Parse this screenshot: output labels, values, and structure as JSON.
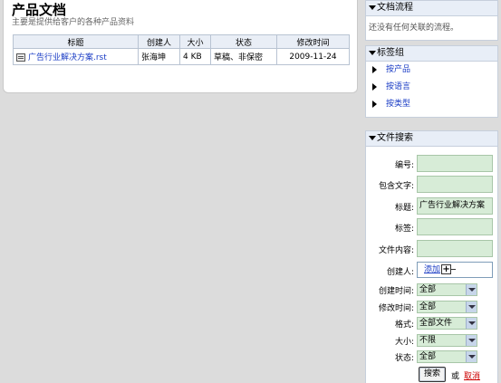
{
  "main": {
    "title": "产品文档",
    "subtitle": "主要是提供给客户的各种产品资料",
    "table": {
      "headers": [
        "标题",
        "创建人",
        "大小",
        "状态",
        "修改时间"
      ],
      "rows": [
        {
          "title": "广告行业解决方案.rst",
          "creator": "张海坤",
          "size": "4 KB",
          "status": "草稿、非保密",
          "modified": "2009-11-24"
        }
      ]
    }
  },
  "workflow": {
    "header": "文档流程",
    "note": "还没有任何关联的流程。"
  },
  "tags": {
    "header": "标签组",
    "items": [
      {
        "label": "按产品"
      },
      {
        "label": "按语言"
      },
      {
        "label": "按类型"
      }
    ]
  },
  "search": {
    "header": "文件搜索",
    "labels": {
      "number": "编号:",
      "contains_text": "包含文字:",
      "title": "标题:",
      "tag": "标签:",
      "content": "文件内容:",
      "creator": "创建人:",
      "created_time": "创建时间:",
      "modified_time": "修改时间:",
      "format": "格式:",
      "size": "大小:",
      "status": "状态:"
    },
    "values": {
      "number": "",
      "contains_text": "",
      "title": "广告行业解决方案",
      "tag": "",
      "content": ""
    },
    "add_link": "添加",
    "selects": {
      "created_time": "全部",
      "modified_time": "全部",
      "format": "全部文件",
      "size": "不限",
      "status": "全部"
    },
    "search_button": "搜索",
    "or": "或",
    "cancel": "取消"
  }
}
